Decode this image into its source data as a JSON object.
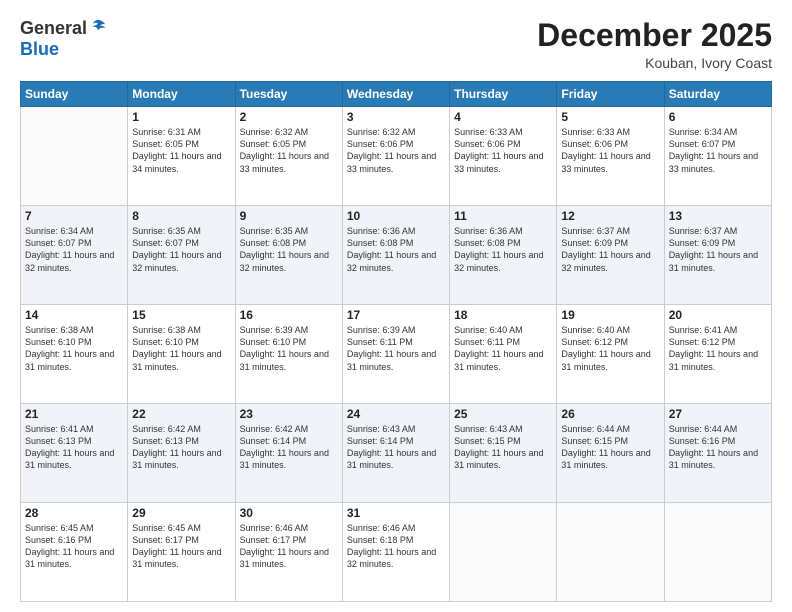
{
  "header": {
    "logo_general": "General",
    "logo_blue": "Blue",
    "month": "December 2025",
    "location": "Kouban, Ivory Coast"
  },
  "days_of_week": [
    "Sunday",
    "Monday",
    "Tuesday",
    "Wednesday",
    "Thursday",
    "Friday",
    "Saturday"
  ],
  "weeks": [
    [
      {
        "day": "",
        "sunrise": "",
        "sunset": "",
        "daylight": ""
      },
      {
        "day": "1",
        "sunrise": "Sunrise: 6:31 AM",
        "sunset": "Sunset: 6:05 PM",
        "daylight": "Daylight: 11 hours and 34 minutes."
      },
      {
        "day": "2",
        "sunrise": "Sunrise: 6:32 AM",
        "sunset": "Sunset: 6:05 PM",
        "daylight": "Daylight: 11 hours and 33 minutes."
      },
      {
        "day": "3",
        "sunrise": "Sunrise: 6:32 AM",
        "sunset": "Sunset: 6:06 PM",
        "daylight": "Daylight: 11 hours and 33 minutes."
      },
      {
        "day": "4",
        "sunrise": "Sunrise: 6:33 AM",
        "sunset": "Sunset: 6:06 PM",
        "daylight": "Daylight: 11 hours and 33 minutes."
      },
      {
        "day": "5",
        "sunrise": "Sunrise: 6:33 AM",
        "sunset": "Sunset: 6:06 PM",
        "daylight": "Daylight: 11 hours and 33 minutes."
      },
      {
        "day": "6",
        "sunrise": "Sunrise: 6:34 AM",
        "sunset": "Sunset: 6:07 PM",
        "daylight": "Daylight: 11 hours and 33 minutes."
      }
    ],
    [
      {
        "day": "7",
        "sunrise": "Sunrise: 6:34 AM",
        "sunset": "Sunset: 6:07 PM",
        "daylight": "Daylight: 11 hours and 32 minutes."
      },
      {
        "day": "8",
        "sunrise": "Sunrise: 6:35 AM",
        "sunset": "Sunset: 6:07 PM",
        "daylight": "Daylight: 11 hours and 32 minutes."
      },
      {
        "day": "9",
        "sunrise": "Sunrise: 6:35 AM",
        "sunset": "Sunset: 6:08 PM",
        "daylight": "Daylight: 11 hours and 32 minutes."
      },
      {
        "day": "10",
        "sunrise": "Sunrise: 6:36 AM",
        "sunset": "Sunset: 6:08 PM",
        "daylight": "Daylight: 11 hours and 32 minutes."
      },
      {
        "day": "11",
        "sunrise": "Sunrise: 6:36 AM",
        "sunset": "Sunset: 6:08 PM",
        "daylight": "Daylight: 11 hours and 32 minutes."
      },
      {
        "day": "12",
        "sunrise": "Sunrise: 6:37 AM",
        "sunset": "Sunset: 6:09 PM",
        "daylight": "Daylight: 11 hours and 32 minutes."
      },
      {
        "day": "13",
        "sunrise": "Sunrise: 6:37 AM",
        "sunset": "Sunset: 6:09 PM",
        "daylight": "Daylight: 11 hours and 31 minutes."
      }
    ],
    [
      {
        "day": "14",
        "sunrise": "Sunrise: 6:38 AM",
        "sunset": "Sunset: 6:10 PM",
        "daylight": "Daylight: 11 hours and 31 minutes."
      },
      {
        "day": "15",
        "sunrise": "Sunrise: 6:38 AM",
        "sunset": "Sunset: 6:10 PM",
        "daylight": "Daylight: 11 hours and 31 minutes."
      },
      {
        "day": "16",
        "sunrise": "Sunrise: 6:39 AM",
        "sunset": "Sunset: 6:10 PM",
        "daylight": "Daylight: 11 hours and 31 minutes."
      },
      {
        "day": "17",
        "sunrise": "Sunrise: 6:39 AM",
        "sunset": "Sunset: 6:11 PM",
        "daylight": "Daylight: 11 hours and 31 minutes."
      },
      {
        "day": "18",
        "sunrise": "Sunrise: 6:40 AM",
        "sunset": "Sunset: 6:11 PM",
        "daylight": "Daylight: 11 hours and 31 minutes."
      },
      {
        "day": "19",
        "sunrise": "Sunrise: 6:40 AM",
        "sunset": "Sunset: 6:12 PM",
        "daylight": "Daylight: 11 hours and 31 minutes."
      },
      {
        "day": "20",
        "sunrise": "Sunrise: 6:41 AM",
        "sunset": "Sunset: 6:12 PM",
        "daylight": "Daylight: 11 hours and 31 minutes."
      }
    ],
    [
      {
        "day": "21",
        "sunrise": "Sunrise: 6:41 AM",
        "sunset": "Sunset: 6:13 PM",
        "daylight": "Daylight: 11 hours and 31 minutes."
      },
      {
        "day": "22",
        "sunrise": "Sunrise: 6:42 AM",
        "sunset": "Sunset: 6:13 PM",
        "daylight": "Daylight: 11 hours and 31 minutes."
      },
      {
        "day": "23",
        "sunrise": "Sunrise: 6:42 AM",
        "sunset": "Sunset: 6:14 PM",
        "daylight": "Daylight: 11 hours and 31 minutes."
      },
      {
        "day": "24",
        "sunrise": "Sunrise: 6:43 AM",
        "sunset": "Sunset: 6:14 PM",
        "daylight": "Daylight: 11 hours and 31 minutes."
      },
      {
        "day": "25",
        "sunrise": "Sunrise: 6:43 AM",
        "sunset": "Sunset: 6:15 PM",
        "daylight": "Daylight: 11 hours and 31 minutes."
      },
      {
        "day": "26",
        "sunrise": "Sunrise: 6:44 AM",
        "sunset": "Sunset: 6:15 PM",
        "daylight": "Daylight: 11 hours and 31 minutes."
      },
      {
        "day": "27",
        "sunrise": "Sunrise: 6:44 AM",
        "sunset": "Sunset: 6:16 PM",
        "daylight": "Daylight: 11 hours and 31 minutes."
      }
    ],
    [
      {
        "day": "28",
        "sunrise": "Sunrise: 6:45 AM",
        "sunset": "Sunset: 6:16 PM",
        "daylight": "Daylight: 11 hours and 31 minutes."
      },
      {
        "day": "29",
        "sunrise": "Sunrise: 6:45 AM",
        "sunset": "Sunset: 6:17 PM",
        "daylight": "Daylight: 11 hours and 31 minutes."
      },
      {
        "day": "30",
        "sunrise": "Sunrise: 6:46 AM",
        "sunset": "Sunset: 6:17 PM",
        "daylight": "Daylight: 11 hours and 31 minutes."
      },
      {
        "day": "31",
        "sunrise": "Sunrise: 6:46 AM",
        "sunset": "Sunset: 6:18 PM",
        "daylight": "Daylight: 11 hours and 32 minutes."
      },
      {
        "day": "",
        "sunrise": "",
        "sunset": "",
        "daylight": ""
      },
      {
        "day": "",
        "sunrise": "",
        "sunset": "",
        "daylight": ""
      },
      {
        "day": "",
        "sunrise": "",
        "sunset": "",
        "daylight": ""
      }
    ]
  ]
}
